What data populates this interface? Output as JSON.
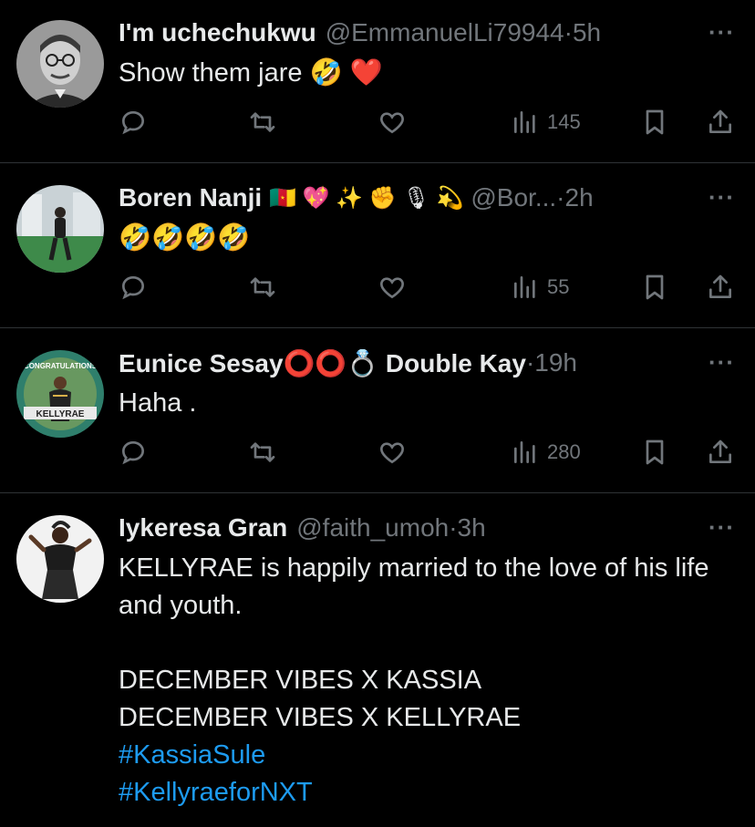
{
  "tweets": [
    {
      "name": "I'm uchechukwu",
      "handle": "@EmmanuelLi79944",
      "sep": " · ",
      "time": "5h",
      "text": "Show them jare 🤣 ❤️",
      "views": "145"
    },
    {
      "name": "Boren Nanji",
      "name_emojis": "🇨🇲 💖 ✨ ✊ 🎙 💫",
      "handle": "@Bor...",
      "sep": " · ",
      "time": "2h",
      "text": "🤣🤣🤣🤣",
      "views": "55"
    },
    {
      "name": "Eunice Sesay⭕⭕💍 Double Kay",
      "handle": "",
      "sep": " · ",
      "time": "19h",
      "text": "Haha .",
      "views": "280",
      "avatar_text_top": "CONGRATULATIONS",
      "avatar_text_bottom": "KELLYRAE"
    },
    {
      "name": "Iykeresa Gran",
      "handle": "@faith_umoh",
      "sep": " · ",
      "time": "3h",
      "text": "KELLYRAE is happily married to the love of his life and youth.\n\nDECEMBER VIBES X KASSIA\nDECEMBER VIBES X KELLYRAE",
      "hashtags": [
        "#KassiaSule",
        "#KellyraeforNXT"
      ]
    }
  ],
  "more_label": "···",
  "icons": {
    "reply": "reply-icon",
    "retweet": "retweet-icon",
    "like": "heart-icon",
    "views": "views-icon",
    "bookmark": "bookmark-icon",
    "share": "share-icon"
  },
  "colors": {
    "background": "#000000",
    "text": "#e7e9ea",
    "secondary": "#71767b",
    "link": "#1d9bf0",
    "divider": "#2f3336"
  }
}
